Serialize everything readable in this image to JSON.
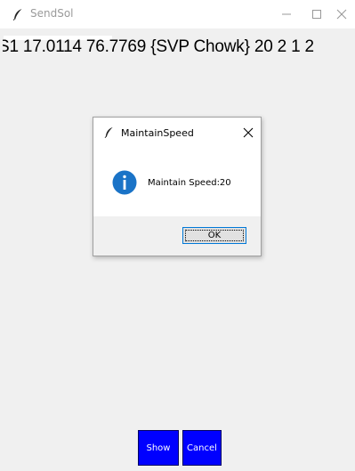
{
  "window": {
    "title": "SendSol"
  },
  "main": {
    "entry_value": "",
    "data_text": "S1 17.0114 76.7769 {SVP Chowk} 20 2 1 2"
  },
  "dialog": {
    "title": "MaintainSpeed",
    "message": "Maintain Speed:20",
    "ok_label": "OK"
  },
  "buttons": {
    "show_label": "Show",
    "cancel_label": "Cancel"
  },
  "colors": {
    "button_blue": "#0000ff",
    "info_blue": "#1a73c7",
    "focus_border": "#0078d7"
  },
  "icons": {
    "app": "feather-icon",
    "dialog": "feather-icon",
    "info": "info-icon"
  }
}
